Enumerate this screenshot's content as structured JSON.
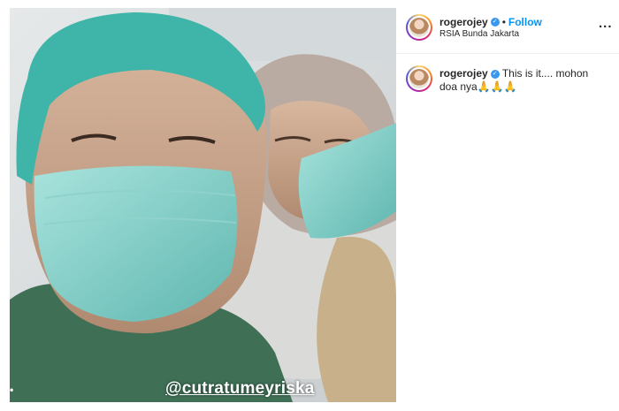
{
  "post": {
    "watermark": "@cutratumeyriska",
    "corner_badge": "•"
  },
  "header": {
    "username": "rogerojey",
    "verified_icon": "verified-badge-icon",
    "separator": "•",
    "follow_label": "Follow",
    "location": "RSIA Bunda Jakarta",
    "more_label": "..."
  },
  "caption": {
    "username": "rogerojey",
    "text": "This is it.... mohon doa nya🙏🙏🙏"
  },
  "colors": {
    "follow": "#0095f6",
    "verified": "#3897f0",
    "text": "#262626"
  }
}
